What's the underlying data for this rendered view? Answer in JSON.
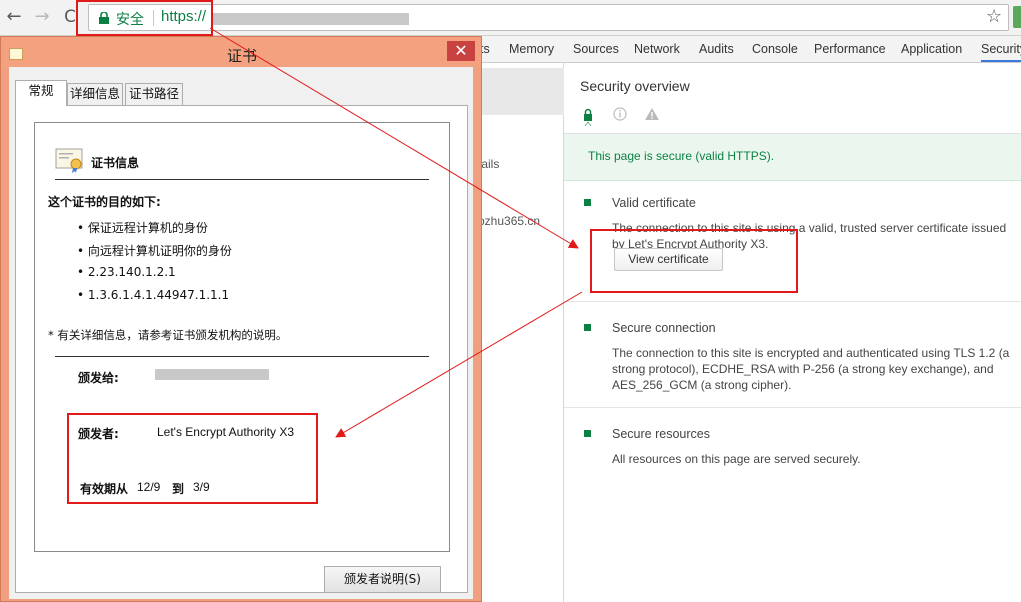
{
  "browser": {
    "back_glyph": "←",
    "forward_glyph": "→",
    "reload_glyph": "C",
    "secure_label": "安全",
    "url_scheme": "https://",
    "star_glyph": "☆",
    "secure_color": "#0b8043"
  },
  "devtools": {
    "tabs": [
      "ts",
      "Memory",
      "Sources",
      "Network",
      "Audits",
      "Console",
      "Performance",
      "Application",
      "Security"
    ],
    "left_texts": [
      "tails",
      "ozhu365.cn"
    ],
    "security_title": "Security overview",
    "banner": "This page is secure (valid HTTPS).",
    "sections": [
      {
        "heading": "Valid certificate",
        "body": "The connection to this site is using a valid, trusted server certificate issued by Let's Encrypt Authority X3.",
        "button": "View certificate"
      },
      {
        "heading": "Secure connection",
        "body": "The connection to this site is encrypted and authenticated using TLS 1.2 (a strong protocol), ECDHE_RSA with P-256 (a strong key exchange), and AES_256_GCM (a strong cipher)."
      },
      {
        "heading": "Secure resources",
        "body": "All resources on this page are served securely."
      }
    ]
  },
  "cert_dialog": {
    "title": "证书",
    "close_glyph": "✕",
    "tabs": [
      "常规",
      "详细信息",
      "证书路径"
    ],
    "info_title": "证书信息",
    "purpose_heading": "这个证书的目的如下:",
    "purposes": [
      "• 保证远程计算机的身份",
      "• 向远程计算机证明你的身份",
      "• 2.23.140.1.2.1",
      "• 1.3.6.1.4.1.44947.1.1.1"
    ],
    "more_info": "* 有关详细信息，请参考证书颁发机构的说明。",
    "issued_to_label": "颁发给:",
    "issued_by_label": "颁发者:",
    "issued_by_value": "Let's Encrypt Authority X3",
    "valid_from_label": "有效期从",
    "valid_from": "12/9",
    "valid_to_label": "到",
    "valid_to": "3/9",
    "issuer_statement_button": "颁发者说明(S)"
  },
  "annotation_color": "#e11919"
}
